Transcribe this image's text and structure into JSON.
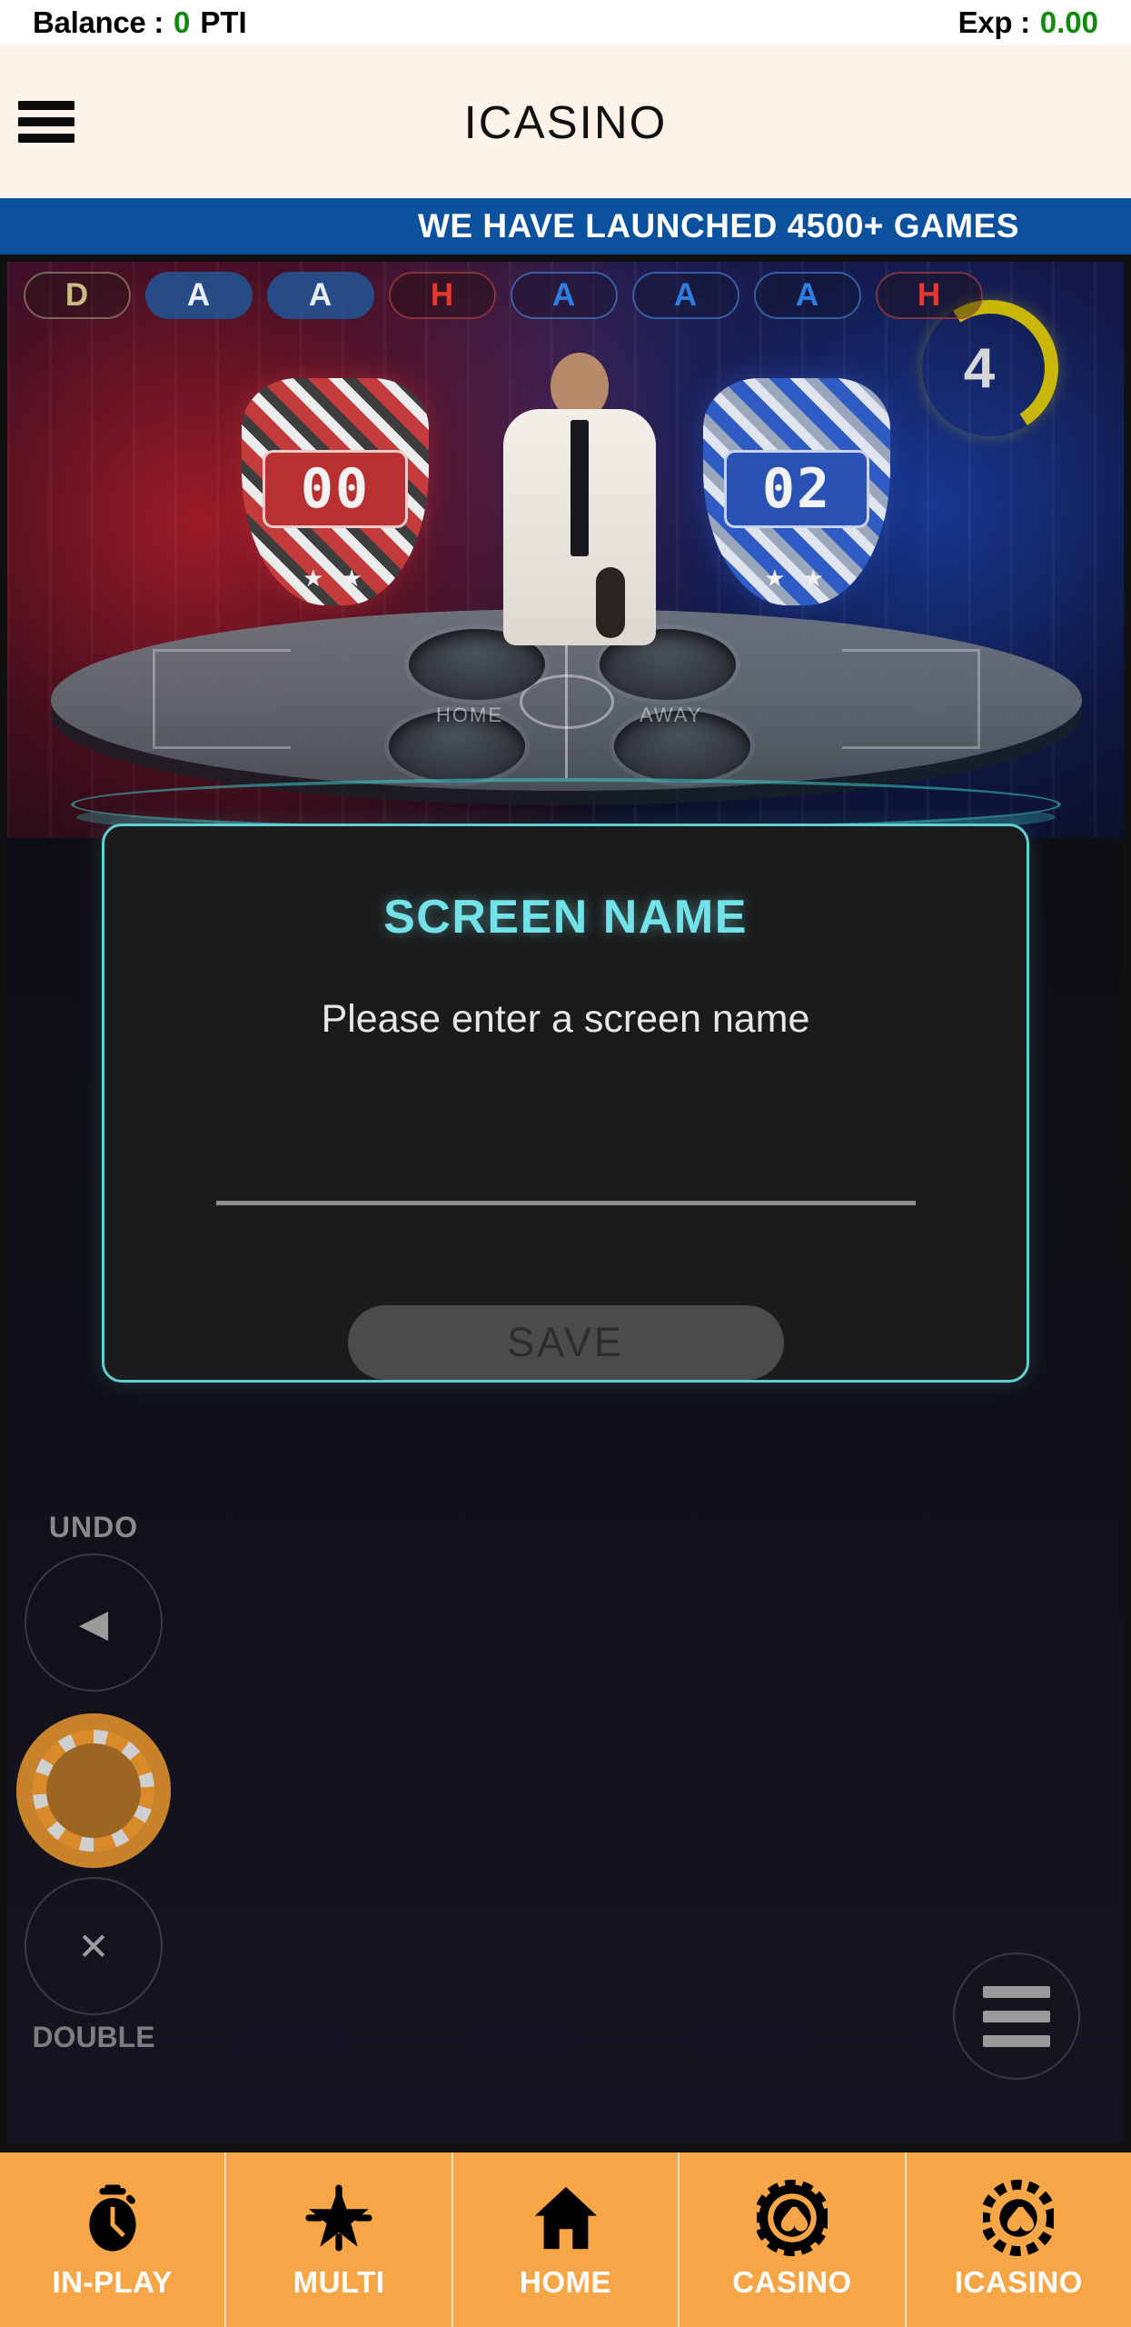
{
  "balance_bar": {
    "balance_label": "Balance :",
    "balance_value": "0",
    "currency": "PTI",
    "exp_label": "Exp :",
    "exp_value": "0.00",
    "value_color": "#128a12"
  },
  "header": {
    "title": "ICASINO",
    "menu_icon": "hamburger-icon",
    "background": "#fdf3e8"
  },
  "ticker": {
    "text": "WE HAVE LAUNCHED 4500+ GAMES",
    "background": "#0b519e",
    "text_color": "#ffffff"
  },
  "game": {
    "history": [
      {
        "label": "D",
        "style": "draw"
      },
      {
        "label": "A",
        "style": "away-solid"
      },
      {
        "label": "A",
        "style": "away-solid"
      },
      {
        "label": "H",
        "style": "home"
      },
      {
        "label": "A",
        "style": "away"
      },
      {
        "label": "A",
        "style": "away"
      },
      {
        "label": "A",
        "style": "away"
      },
      {
        "label": "H",
        "style": "home"
      }
    ],
    "score_home": "00",
    "score_away": "02",
    "countdown": "4",
    "table_labels": {
      "home": "HOME",
      "away": "AWAY"
    },
    "stars": "★ ★"
  },
  "bet_controls": {
    "undo_label": "UNDO",
    "undo_icon": "undo-arrow-icon",
    "chip_icon": "casino-chip-icon",
    "clear_icon": "close-x-icon",
    "double_label": "DOUBLE"
  },
  "modal": {
    "title": "SCREEN NAME",
    "subtitle": "Please enter a screen name",
    "input_value": "",
    "input_placeholder": "",
    "save_label": "SAVE",
    "save_enabled": false,
    "border_color": "#5fcfd0",
    "title_color": "#72e2e8"
  },
  "floating_menu": {
    "icon": "hamburger-icon"
  },
  "bottom_nav": {
    "background": "#f7a647",
    "items": [
      {
        "label": "IN-PLAY",
        "icon": "stopwatch-icon"
      },
      {
        "label": "MULTI",
        "icon": "star-burst-icon"
      },
      {
        "label": "HOME",
        "icon": "house-icon"
      },
      {
        "label": "CASINO",
        "icon": "casino-chip-icon"
      },
      {
        "label": "ICASINO",
        "icon": "casino-chip-icon"
      }
    ]
  }
}
